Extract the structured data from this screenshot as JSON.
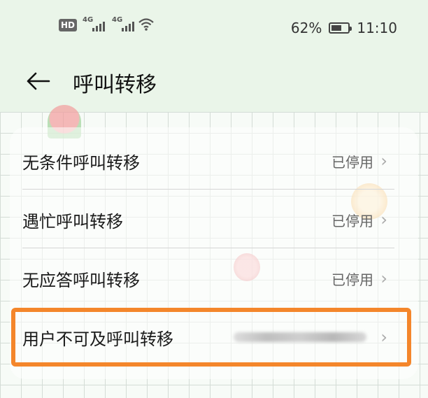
{
  "status_bar": {
    "hd_label": "HD",
    "sim1": "4G",
    "sim2": "4G",
    "battery_percent": "62%",
    "battery_level": 0.62,
    "time": "11:10"
  },
  "header": {
    "title": "呼叫转移"
  },
  "rows": [
    {
      "label": "无条件呼叫转移",
      "value": "已停用"
    },
    {
      "label": "遇忙呼叫转移",
      "value": "已停用"
    },
    {
      "label": "无应答呼叫转移",
      "value": "已停用"
    },
    {
      "label": "用户不可及呼叫转移",
      "value": ""
    }
  ],
  "colors": {
    "highlight": "#f4862b",
    "header_bg": "#eaf5e9"
  }
}
